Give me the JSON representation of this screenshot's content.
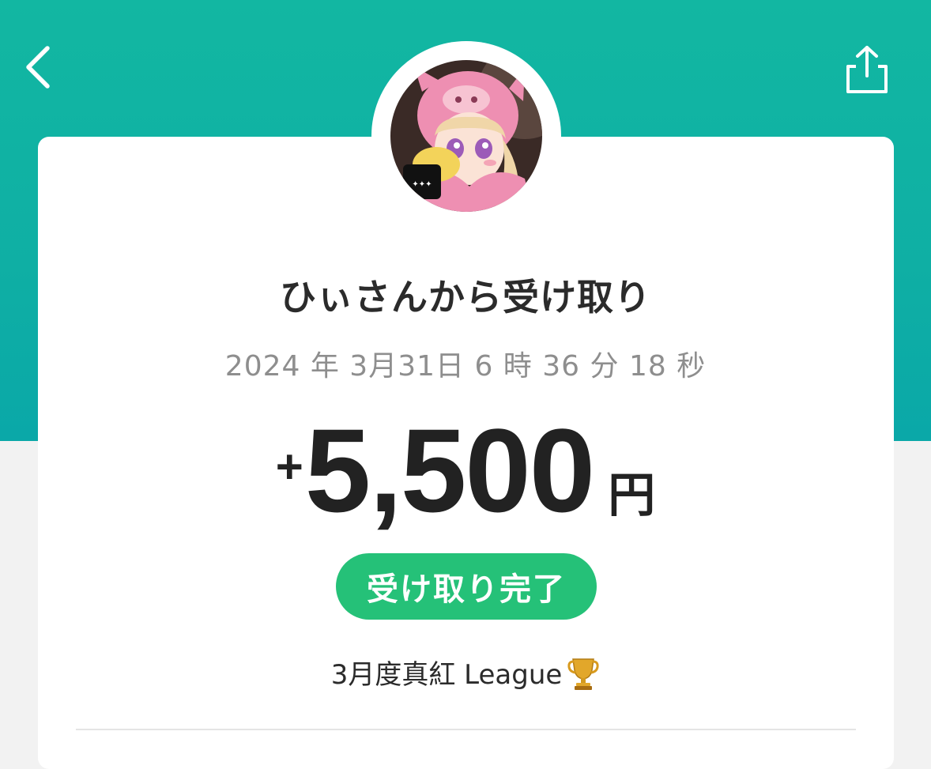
{
  "header": {
    "back_icon": "chevron-left-icon",
    "share_icon": "share-icon",
    "accent_color": "#12b7a2"
  },
  "transaction": {
    "title": "ひぃさんから受け取り",
    "datetime": "2024 年 3月31日 6 時 36 分 18 秒",
    "amount_sign": "+",
    "amount": "5,500",
    "currency": "円",
    "status": "受け取り完了",
    "status_color": "#25c178",
    "memo": "3月度真紅 League",
    "memo_icon": "trophy-icon"
  }
}
